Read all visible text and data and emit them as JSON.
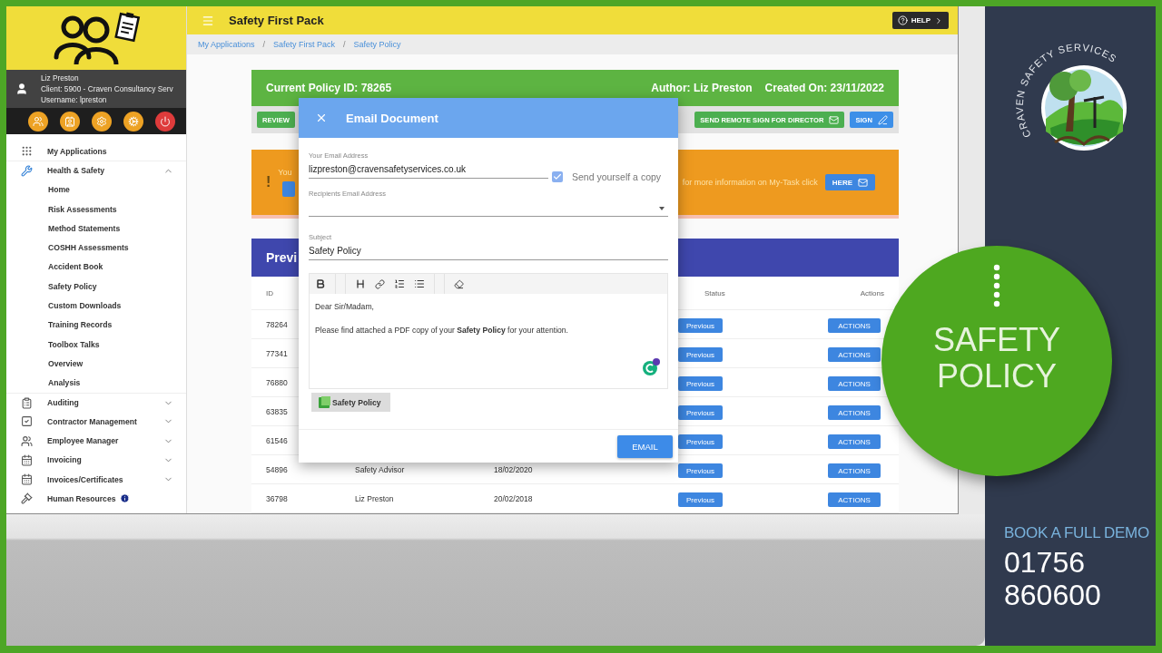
{
  "sidebar": {
    "user": {
      "name": "Liz Preston",
      "client": "Client: 5900 - Craven Consultancy Serv",
      "username": "Username: lpreston"
    },
    "quick_actions": [
      {
        "color": "#eda224"
      },
      {
        "color": "#eda224"
      },
      {
        "color": "#eda224"
      },
      {
        "color": "#eda224"
      },
      {
        "color": "#de3b3b"
      }
    ],
    "menu": [
      {
        "label": "My Applications"
      },
      {
        "label": "Health & Safety",
        "expanded": true,
        "children": [
          {
            "label": "Home"
          },
          {
            "label": "Risk Assessments"
          },
          {
            "label": "Method Statements"
          },
          {
            "label": "COSHH Assessments"
          },
          {
            "label": "Accident Book"
          },
          {
            "label": "Safety Policy"
          },
          {
            "label": "Custom Downloads"
          },
          {
            "label": "Training Records"
          },
          {
            "label": "Toolbox Talks"
          },
          {
            "label": "Overview"
          },
          {
            "label": "Analysis"
          }
        ]
      },
      {
        "label": "Auditing",
        "expanded": false
      },
      {
        "label": "Contractor Management",
        "expanded": false
      },
      {
        "label": "Employee Manager",
        "expanded": false
      },
      {
        "label": "Invoicing",
        "expanded": false
      },
      {
        "label": "Invoices/Certificates",
        "expanded": false
      },
      {
        "label": "Human Resources",
        "info": true
      }
    ]
  },
  "header": {
    "title": "Safety First Pack",
    "help_button": "HELP"
  },
  "breadcrumb": {
    "separator": "/",
    "items": [
      "My Applications",
      "Safety First Pack",
      "Safety Policy"
    ]
  },
  "policy": {
    "id_text": "Current Policy ID: 78265",
    "author": "Author: Liz Preston",
    "created": "Created On: 23/11/2022",
    "actions": [
      {
        "label": "REVIEW",
        "kind": "review"
      },
      {
        "label": "SEND REMOTE SIGN FOR DIRECTOR",
        "kind": "remote"
      },
      {
        "label": "SIGN",
        "kind": "sign"
      }
    ]
  },
  "notice": {
    "mark": "!",
    "text_start": "You",
    "text_end": "for more information on My-Task click",
    "button": "HERE"
  },
  "previous": {
    "title": "Previ",
    "columns": [
      "ID",
      "Status",
      "Actions"
    ],
    "rows": [
      {
        "id": "78264",
        "status": "Previous",
        "action": "ACTIONS"
      },
      {
        "id": "77341",
        "status": "Previous",
        "action": "ACTIONS"
      },
      {
        "id": "76880",
        "status": "Previous",
        "action": "ACTIONS"
      },
      {
        "id": "63835",
        "status": "Previous",
        "action": "ACTIONS"
      },
      {
        "id": "61546",
        "status": "Previous",
        "action": "ACTIONS"
      },
      {
        "id": "54896",
        "author": "Safety Advisor",
        "date": "18/02/2020",
        "status": "Previous",
        "action": "ACTIONS"
      },
      {
        "id": "36798",
        "author": "Liz Preston",
        "date": "20/02/2018",
        "status": "Previous",
        "action": "ACTIONS"
      }
    ]
  },
  "email_dialog": {
    "title": "Email Document",
    "your_email": {
      "label": "Your Email Address",
      "value": "lizpreston@cravensafetyservices.co.uk"
    },
    "send_copy": {
      "label": "Send yourself a copy",
      "checked": true
    },
    "recipients": {
      "label": "Recipients Email Address"
    },
    "subject": {
      "label": "Subject",
      "value": "Safety Policy"
    },
    "body": [
      "Dear Sir/Madam,",
      "Please find attached a PDF copy of your **Safety Policy** for your attention."
    ],
    "attachment": "Safety Policy",
    "button": "EMAIL"
  },
  "promo": {
    "logo_text": "CRAVEN SAFETY SERVICES",
    "badge_title": "SAFETY POLICY",
    "cta": "BOOK A FULL DEMO",
    "phone": [
      "01756",
      "860600"
    ]
  }
}
